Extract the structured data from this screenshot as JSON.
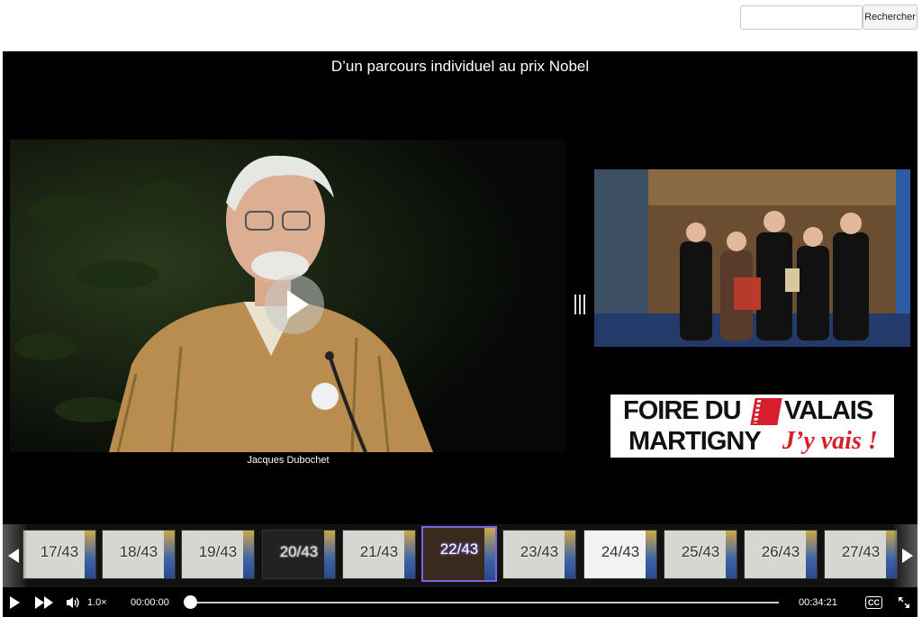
{
  "search": {
    "placeholder": "",
    "button_label": "Rechercher"
  },
  "player": {
    "title": "D’un parcours individuel au prix Nobel",
    "speaker_caption": "Jacques Dubochet"
  },
  "sponsor": {
    "line1": "FOIRE DU",
    "line1b": "VALAIS",
    "line2": "MARTIGNY",
    "tagline": "J’y vais !"
  },
  "thumbnails": [
    {
      "label": "17/43"
    },
    {
      "label": "18/43"
    },
    {
      "label": "19/43"
    },
    {
      "label": "20/43"
    },
    {
      "label": "21/43"
    },
    {
      "label": "22/43",
      "active": true
    },
    {
      "label": "23/43"
    },
    {
      "label": "24/43"
    },
    {
      "label": "25/43"
    },
    {
      "label": "26/43"
    },
    {
      "label": "27/43"
    }
  ],
  "controls": {
    "rate": "1.0×",
    "current_time": "00:00:00",
    "duration": "00:34:21",
    "progress_fraction": 0,
    "cc_label": "CC"
  },
  "icons": {
    "play": "play-icon",
    "fast_forward": "fast-forward-icon",
    "volume": "volume-icon",
    "captions": "captions-icon",
    "fullscreen": "fullscreen-icon",
    "prev": "arrow-left-icon",
    "next": "arrow-right-icon"
  },
  "colors": {
    "active_thumb_border": "#7a63e6",
    "sponsor_red": "#d81e2a"
  }
}
